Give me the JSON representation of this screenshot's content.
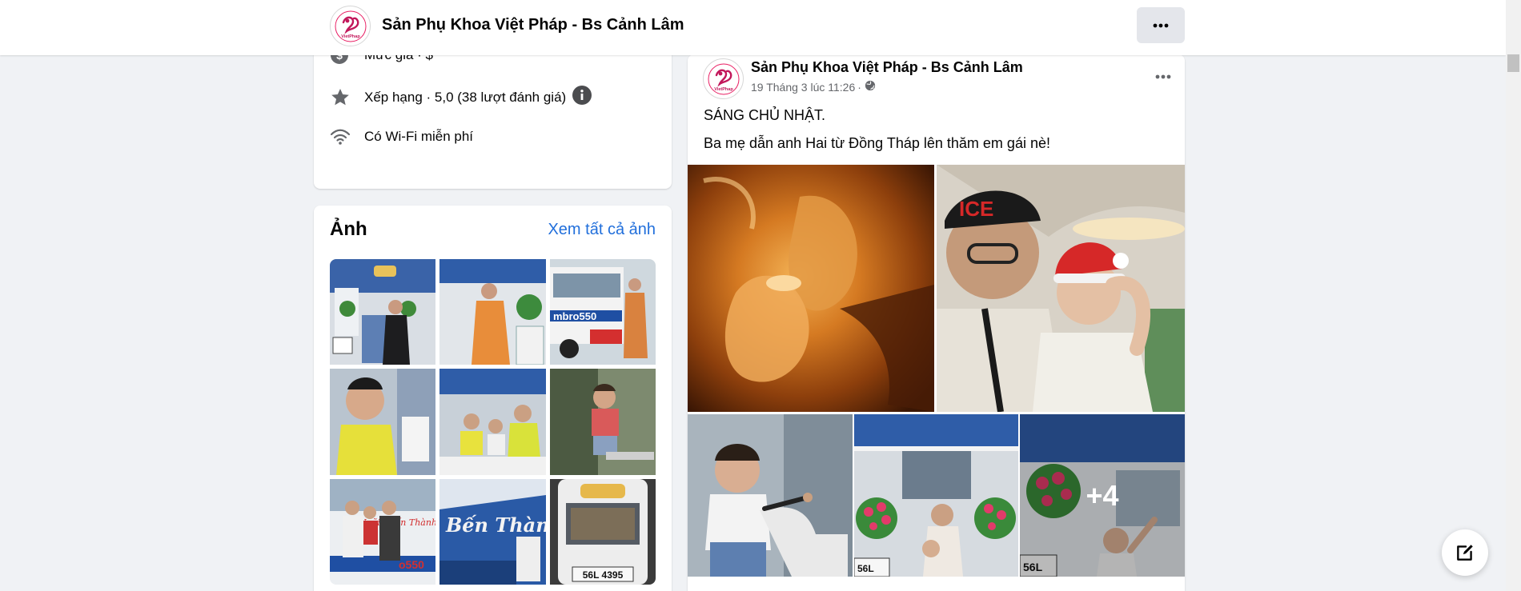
{
  "header": {
    "title": "Sản Phụ Khoa Việt Pháp - Bs Cảnh Lâm",
    "logo_text": "VietPhap"
  },
  "info": {
    "price": {
      "label": "Mức giá · $",
      "icon": "price-icon"
    },
    "rating": {
      "label": "Xếp hạng · 5,0 (38 lượt đánh giá)",
      "icon": "star-icon"
    },
    "wifi": {
      "label": "Có Wi-Fi miễn phí",
      "icon": "wifi-icon"
    }
  },
  "photos": {
    "heading": "Ảnh",
    "see_all": "Xem tất cả ảnh",
    "plate_1": "56L 4395"
  },
  "post": {
    "author": "Sản Phụ Khoa Việt Pháp - Bs Cảnh Lâm",
    "timestamp": "19 Tháng 3 lúc 11:26",
    "line1": "SÁNG CHỦ NHẬT.",
    "line2": "Ba mẹ dẫn anh Hai từ Đồng Tháp lên thăm em gái nè!",
    "more_count": "+4",
    "cap_text": "ICE",
    "plate": "56L"
  },
  "colors": {
    "link": "#216fdb",
    "page_bg": "#f0f2f5",
    "brand_pink": "#c2185b"
  }
}
